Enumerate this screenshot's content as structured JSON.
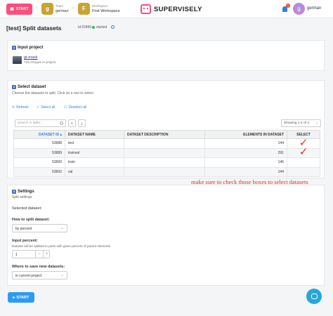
{
  "topbar": {
    "start_label": "START",
    "team": {
      "avatar": "g",
      "label": "Team",
      "name": "german"
    },
    "workspace": {
      "avatar": "F",
      "label": "Workspace",
      "name": "First Workspace"
    },
    "logo": "SUPERVISELY",
    "notifications_count": "1",
    "user": {
      "avatar": "g",
      "name": "german"
    }
  },
  "page": {
    "title": "[test] Split datasets",
    "task_id": "id:23450",
    "status": "started"
  },
  "input_project": {
    "step": "1",
    "title": "Input project",
    "project_name": "gt-mask",
    "project_info": "725 images in project"
  },
  "select_dataset": {
    "step": "2",
    "title": "Select dataset",
    "subtitle": "Choose the datasets to split. Click on a row to select",
    "refresh": "Refresh",
    "select_all": "Select all",
    "deselect_all": "Deselect all",
    "search_placeholder": "Search in table...",
    "pager": "Showing 1-4 of 4",
    "columns": [
      "DATASET ID",
      "DATASET NAME",
      "DATASET DESCRIPTION",
      "ELEMENTS IN DATASET",
      "SELECT"
    ],
    "rows": [
      {
        "id": "53688",
        "name": "test",
        "description": "",
        "elements": "144",
        "selected": true
      },
      {
        "id": "53689",
        "name": "trainval",
        "description": "",
        "elements": "291",
        "selected": true
      },
      {
        "id": "53690",
        "name": "train",
        "description": "",
        "elements": "146",
        "selected": false
      },
      {
        "id": "53692",
        "name": "val",
        "description": "",
        "elements": "144",
        "selected": false
      }
    ]
  },
  "annotation": "make sure to check those boxes to select datasets",
  "settings": {
    "step": "3",
    "title": "Settings",
    "subtitle": "Split settings",
    "selected_label": "Selected dataset:",
    "how_label": "How to split dataset:",
    "how_value": "by percent",
    "percent_label": "Input percent:",
    "percent_hint": "Dataset will be splitted to parts with given percent of parent elements",
    "percent_value": "1",
    "where_label": "Where to save new datasets:",
    "where_value": "in current project"
  },
  "footer": {
    "start_label": "START"
  },
  "colors": {
    "accent": "#3a7be0",
    "brand_pink": "#ff4d7d",
    "start_blue": "#2d9cf0",
    "annotation_red": "#e0301e"
  }
}
